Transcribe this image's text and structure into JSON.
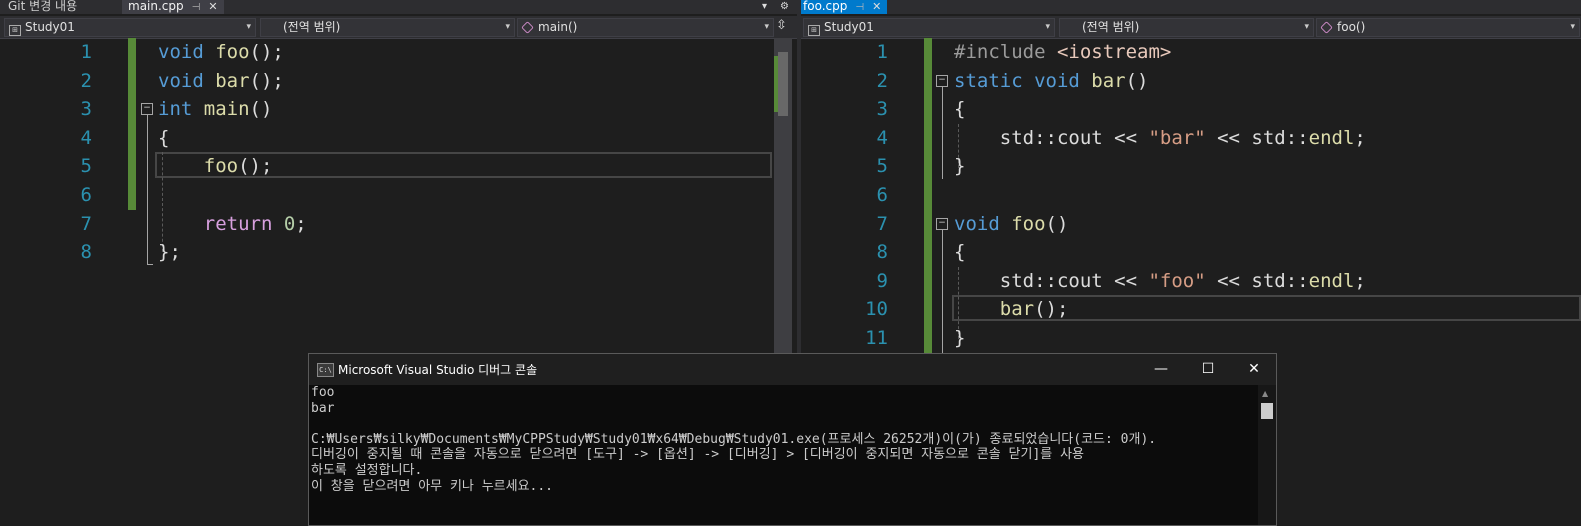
{
  "left": {
    "tabs": [
      {
        "label": "Git 변경 내용",
        "active": false
      },
      {
        "label": "main.cpp",
        "active": true
      }
    ],
    "nav": {
      "project": "Study01",
      "scope": "(전역 범위)",
      "member": "main()"
    },
    "lines": [
      {
        "num": "1",
        "segments": [
          {
            "t": "void ",
            "c": "kw"
          },
          {
            "t": "foo",
            "c": "fn"
          },
          {
            "t": "();",
            "c": ""
          }
        ]
      },
      {
        "num": "2",
        "segments": [
          {
            "t": "void ",
            "c": "kw"
          },
          {
            "t": "bar",
            "c": "fn"
          },
          {
            "t": "();",
            "c": ""
          }
        ]
      },
      {
        "num": "3",
        "segments": [
          {
            "t": "int ",
            "c": "kw"
          },
          {
            "t": "main",
            "c": "fn"
          },
          {
            "t": "()",
            "c": ""
          }
        ]
      },
      {
        "num": "4",
        "segments": [
          {
            "t": "{",
            "c": ""
          }
        ]
      },
      {
        "num": "5",
        "segments": [
          {
            "t": "    ",
            "c": ""
          },
          {
            "t": "foo",
            "c": "fn"
          },
          {
            "t": "();",
            "c": ""
          }
        ]
      },
      {
        "num": "6",
        "segments": []
      },
      {
        "num": "7",
        "segments": [
          {
            "t": "    ",
            "c": ""
          },
          {
            "t": "return ",
            "c": "ctl"
          },
          {
            "t": "0",
            "c": "num"
          },
          {
            "t": ";",
            "c": ""
          }
        ]
      },
      {
        "num": "8",
        "segments": [
          {
            "t": "};",
            "c": ""
          }
        ]
      }
    ]
  },
  "right": {
    "tabs": [
      {
        "label": "foo.cpp",
        "active": true
      }
    ],
    "nav": {
      "project": "Study01",
      "scope": "(전역 범위)",
      "member": "foo()"
    },
    "lines": [
      {
        "num": "1",
        "segments": [
          {
            "t": "#include ",
            "c": "pp"
          },
          {
            "t": "<iostream>",
            "c": "inc"
          }
        ]
      },
      {
        "num": "2",
        "segments": [
          {
            "t": "static ",
            "c": "kw"
          },
          {
            "t": "void ",
            "c": "kw"
          },
          {
            "t": "bar",
            "c": "fn"
          },
          {
            "t": "()",
            "c": ""
          }
        ]
      },
      {
        "num": "3",
        "segments": [
          {
            "t": "{",
            "c": ""
          }
        ]
      },
      {
        "num": "4",
        "segments": [
          {
            "t": "    std::cout << ",
            "c": ""
          },
          {
            "t": "\"bar\"",
            "c": "str"
          },
          {
            "t": " << std::",
            "c": ""
          },
          {
            "t": "endl",
            "c": "fn"
          },
          {
            "t": ";",
            "c": ""
          }
        ]
      },
      {
        "num": "5",
        "segments": [
          {
            "t": "}",
            "c": ""
          }
        ]
      },
      {
        "num": "6",
        "segments": []
      },
      {
        "num": "7",
        "segments": [
          {
            "t": "void ",
            "c": "kw"
          },
          {
            "t": "foo",
            "c": "fn"
          },
          {
            "t": "()",
            "c": ""
          }
        ]
      },
      {
        "num": "8",
        "segments": [
          {
            "t": "{",
            "c": ""
          }
        ]
      },
      {
        "num": "9",
        "segments": [
          {
            "t": "    std::cout << ",
            "c": ""
          },
          {
            "t": "\"foo\"",
            "c": "str"
          },
          {
            "t": " << std::",
            "c": ""
          },
          {
            "t": "endl",
            "c": "fn"
          },
          {
            "t": ";",
            "c": ""
          }
        ]
      },
      {
        "num": "10",
        "segments": [
          {
            "t": "    ",
            "c": ""
          },
          {
            "t": "bar",
            "c": "fn"
          },
          {
            "t": "();",
            "c": ""
          }
        ]
      },
      {
        "num": "11",
        "segments": [
          {
            "t": "}",
            "c": ""
          }
        ]
      }
    ]
  },
  "console": {
    "title": "Microsoft Visual Studio 디버그 콘솔",
    "icon_text": "C:\\",
    "lines": [
      "foo",
      "bar",
      "",
      "C:₩Users₩silky₩Documents₩MyCPPStudy₩Study01₩x64₩Debug₩Study01.exe(프로세스 26252개)이(가) 종료되었습니다(코드: 0개).",
      "디버깅이 중지될 때 콘솔을 자동으로 닫으려면 [도구] -> [옵션] -> [디버깅] > [디버깅이 중지되면 자동으로 콘솔 닫기]를 사용",
      "하도록 설정합니다.",
      "이 창을 닫으려면 아무 키나 누르세요..."
    ]
  },
  "icons": {
    "pin": "pin-icon",
    "close": "close-icon",
    "dropdown": "chevron-down-icon",
    "settings": "gear-icon",
    "split": "split-icon",
    "minimize": "minimize-icon",
    "maximize": "maximize-icon",
    "console_close": "close-icon"
  },
  "colors": {
    "editor_bg": "#1e1e1e",
    "keyword": "#569cd6",
    "function": "#dcdcaa",
    "control": "#d8a0df",
    "number": "#b5cea8",
    "string": "#d69d85",
    "line_number": "#2b91af",
    "change_bar": "#578a38",
    "active_tab": "#007acc"
  }
}
